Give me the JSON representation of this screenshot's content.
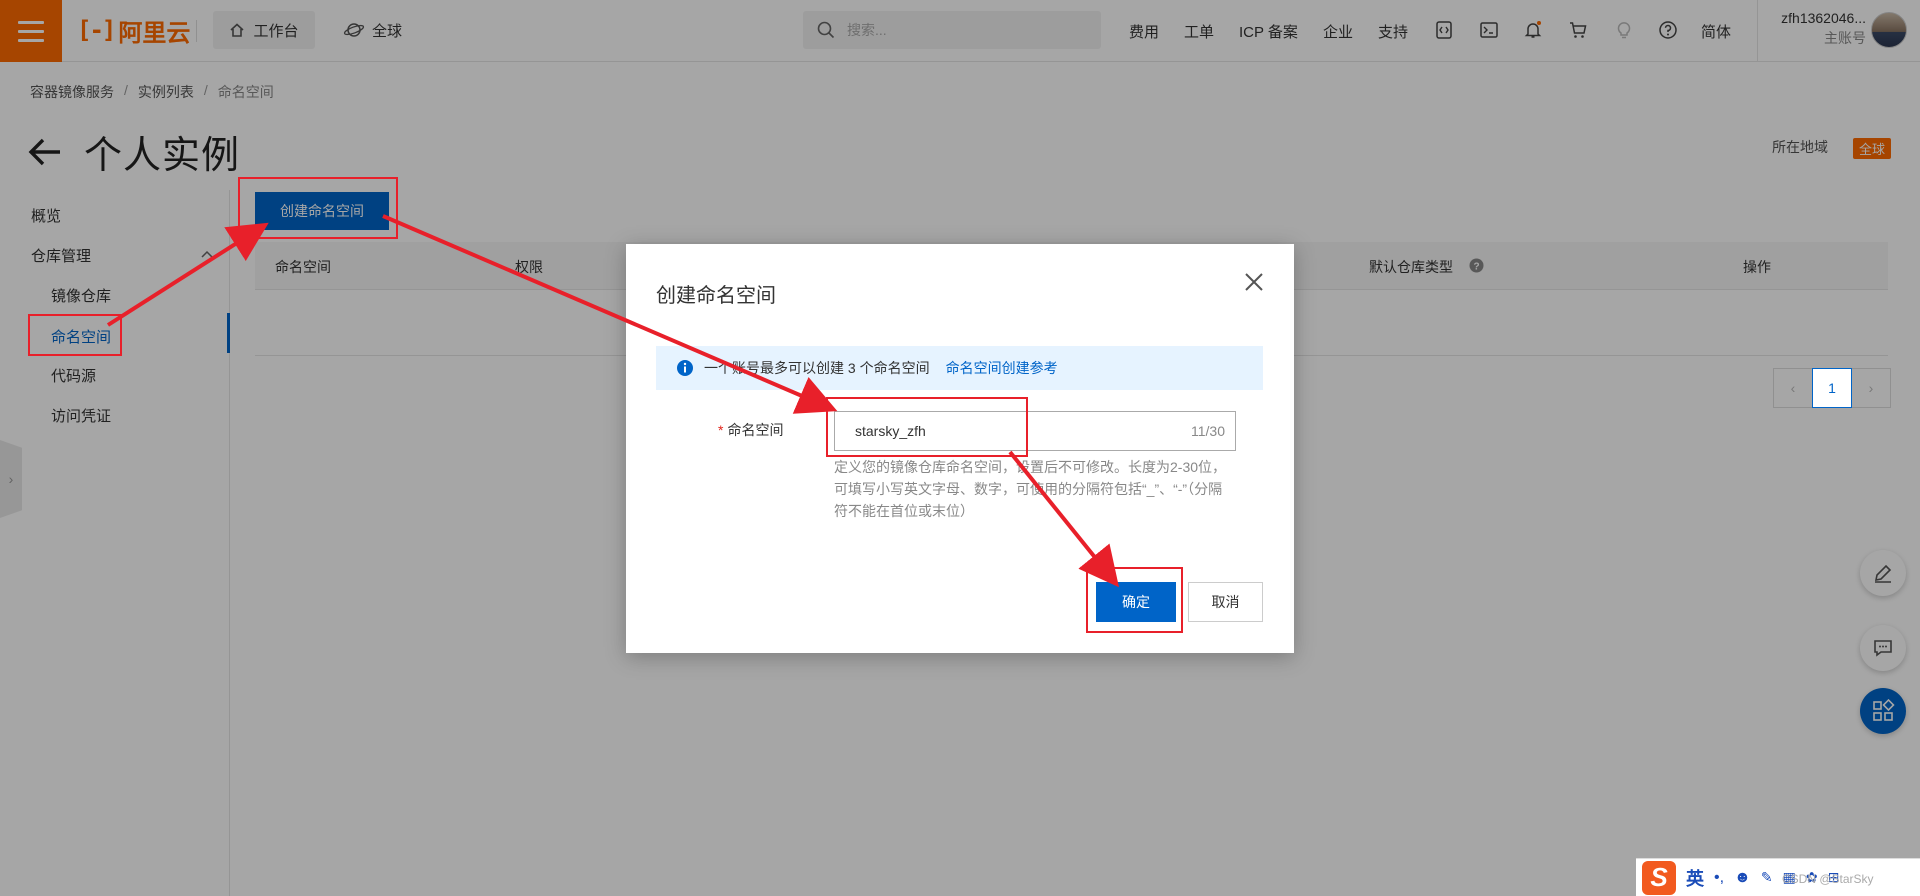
{
  "topbar": {
    "logo_text": "阿里云",
    "workbench": "工作台",
    "region": "全球",
    "search_placeholder": "搜索...",
    "nav": [
      "费用",
      "工单",
      "ICP 备案",
      "企业",
      "支持"
    ],
    "lang": "简体",
    "user_name": "zfh1362046...",
    "user_role": "主账号"
  },
  "breadcrumb": [
    "容器镜像服务",
    "实例列表",
    "命名空间"
  ],
  "page": {
    "title": "个人实例",
    "region_label": "所在地域",
    "region_value": "全球"
  },
  "sidebar": {
    "items": [
      {
        "label": "概览"
      },
      {
        "label": "仓库管理"
      },
      {
        "label": "镜像仓库"
      },
      {
        "label": "命名空间"
      },
      {
        "label": "代码源"
      },
      {
        "label": "访问凭证"
      }
    ]
  },
  "main": {
    "create_button": "创建命名空间",
    "columns": [
      "命名空间",
      "权限",
      "默认仓库类型",
      "操作"
    ],
    "pager": {
      "current": "1"
    }
  },
  "dialog": {
    "title": "创建命名空间",
    "notice": "一个账号最多可以创建 3 个命名空间",
    "notice_link": "命名空间创建参考",
    "field_label": "命名空间",
    "field_required": "*",
    "field_value": "starsky_zfh",
    "field_count": "11/30",
    "help": "定义您的镜像仓库命名空间，设置后不可修改。长度为2-30位，可填写小写英文字母、数字，可使用的分隔符包括“_”、“-”（分隔符不能在首位或末位）",
    "ok": "确定",
    "cancel": "取消"
  },
  "ime": {
    "logo": "S",
    "mode": "英",
    "watermark": "CSDN @StarSky"
  },
  "colors": {
    "brand": "#ff6a00",
    "primary": "#0064c8",
    "annotation": "#e8202a"
  }
}
